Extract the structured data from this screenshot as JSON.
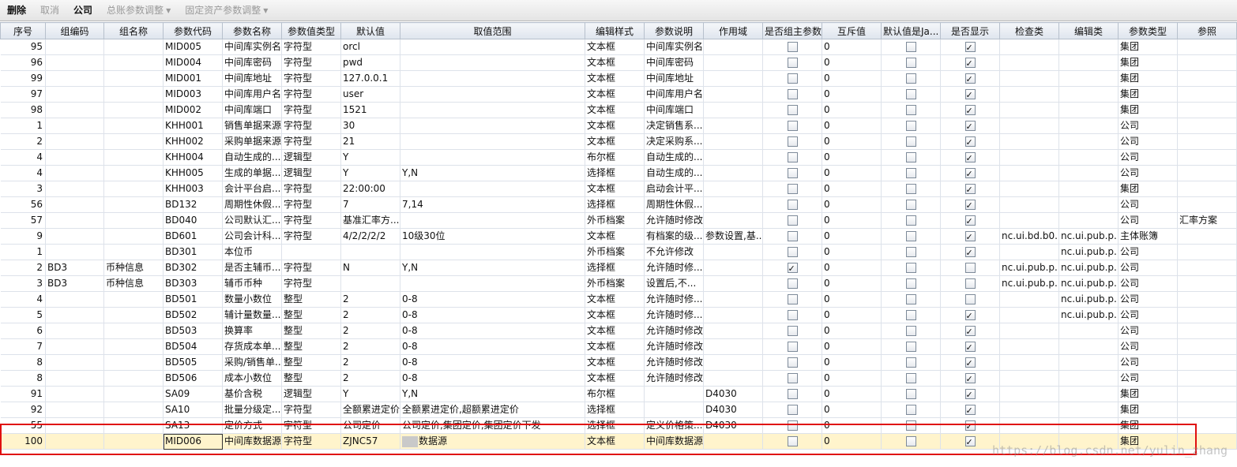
{
  "toolbar": {
    "delete_label": "删除",
    "cancel_label": "取消",
    "company_label": "公司",
    "ledger_params_label": "总账参数调整",
    "asset_params_label": "固定资产参数调整"
  },
  "columns": [
    "序号",
    "组编码",
    "组名称",
    "参数代码",
    "参数名称",
    "参数值类型",
    "默认值",
    "取值范围",
    "编辑样式",
    "参数说明",
    "作用域",
    "是否组主参数",
    "互斥值",
    "默认值是Ja...",
    "是否显示",
    "检查类",
    "编辑类",
    "参数类型",
    "参照"
  ],
  "rows": [
    {
      "seq": "95",
      "gcode": "",
      "gname": "",
      "code": "MID005",
      "name": "中间库实例名",
      "vtype": "字符型",
      "def": "orcl",
      "range": "",
      "style": "文本框",
      "desc": "中间库实例名",
      "scope": "",
      "main": false,
      "mutex": "0",
      "java": false,
      "show": true,
      "check": "",
      "edit": "",
      "ptype": "集团",
      "ref": ""
    },
    {
      "seq": "96",
      "gcode": "",
      "gname": "",
      "code": "MID004",
      "name": "中间库密码",
      "vtype": "字符型",
      "def": "pwd",
      "range": "",
      "style": "文本框",
      "desc": "中间库密码",
      "scope": "",
      "main": false,
      "mutex": "0",
      "java": false,
      "show": true,
      "check": "",
      "edit": "",
      "ptype": "集团",
      "ref": ""
    },
    {
      "seq": "99",
      "gcode": "",
      "gname": "",
      "code": "MID001",
      "name": "中间库地址",
      "vtype": "字符型",
      "def": "127.0.0.1",
      "range": "",
      "style": "文本框",
      "desc": "中间库地址",
      "scope": "",
      "main": false,
      "mutex": "0",
      "java": false,
      "show": true,
      "check": "",
      "edit": "",
      "ptype": "集团",
      "ref": ""
    },
    {
      "seq": "97",
      "gcode": "",
      "gname": "",
      "code": "MID003",
      "name": "中间库用户名",
      "vtype": "字符型",
      "def": "user",
      "range": "",
      "style": "文本框",
      "desc": "中间库用户名",
      "scope": "",
      "main": false,
      "mutex": "0",
      "java": false,
      "show": true,
      "check": "",
      "edit": "",
      "ptype": "集团",
      "ref": ""
    },
    {
      "seq": "98",
      "gcode": "",
      "gname": "",
      "code": "MID002",
      "name": "中间库端口",
      "vtype": "字符型",
      "def": "1521",
      "range": "",
      "style": "文本框",
      "desc": "中间库端口",
      "scope": "",
      "main": false,
      "mutex": "0",
      "java": false,
      "show": true,
      "check": "",
      "edit": "",
      "ptype": "集团",
      "ref": ""
    },
    {
      "seq": "1",
      "gcode": "",
      "gname": "",
      "code": "KHH001",
      "name": "销售单据来源",
      "vtype": "字符型",
      "def": "30",
      "range": "",
      "style": "文本框",
      "desc": "决定销售系...",
      "scope": "",
      "main": false,
      "mutex": "0",
      "java": false,
      "show": true,
      "check": "",
      "edit": "",
      "ptype": "公司",
      "ref": ""
    },
    {
      "seq": "2",
      "gcode": "",
      "gname": "",
      "code": "KHH002",
      "name": "采购单据来源",
      "vtype": "字符型",
      "def": "21",
      "range": "",
      "style": "文本框",
      "desc": "决定采购系...",
      "scope": "",
      "main": false,
      "mutex": "0",
      "java": false,
      "show": true,
      "check": "",
      "edit": "",
      "ptype": "公司",
      "ref": ""
    },
    {
      "seq": "4",
      "gcode": "",
      "gname": "",
      "code": "KHH004",
      "name": "自动生成的...",
      "vtype": "逻辑型",
      "def": "Y",
      "range": "",
      "style": "布尔框",
      "desc": "自动生成的...",
      "scope": "",
      "main": false,
      "mutex": "0",
      "java": false,
      "show": true,
      "check": "",
      "edit": "",
      "ptype": "公司",
      "ref": ""
    },
    {
      "seq": "4",
      "gcode": "",
      "gname": "",
      "code": "KHH005",
      "name": "生成的单据...",
      "vtype": "逻辑型",
      "def": "Y",
      "range": "Y,N",
      "style": "选择框",
      "desc": "自动生成的...",
      "scope": "",
      "main": false,
      "mutex": "0",
      "java": false,
      "show": true,
      "check": "",
      "edit": "",
      "ptype": "公司",
      "ref": ""
    },
    {
      "seq": "3",
      "gcode": "",
      "gname": "",
      "code": "KHH003",
      "name": "会计平台启...",
      "vtype": "字符型",
      "def": "22:00:00",
      "range": "",
      "style": "文本框",
      "desc": "启动会计平...",
      "scope": "",
      "main": false,
      "mutex": "0",
      "java": false,
      "show": true,
      "check": "",
      "edit": "",
      "ptype": "集团",
      "ref": ""
    },
    {
      "seq": "56",
      "gcode": "",
      "gname": "",
      "code": "BD132",
      "name": "周期性休假...",
      "vtype": "字符型",
      "def": "7",
      "range": "7,14",
      "style": "选择框",
      "desc": "周期性休假...",
      "scope": "",
      "main": false,
      "mutex": "0",
      "java": false,
      "show": true,
      "check": "",
      "edit": "",
      "ptype": "公司",
      "ref": ""
    },
    {
      "seq": "57",
      "gcode": "",
      "gname": "",
      "code": "BD040",
      "name": "公司默认汇...",
      "vtype": "字符型",
      "def": "基准汇率方...",
      "range": "",
      "style": "外币档案",
      "desc": "允许随时修改",
      "scope": "",
      "main": false,
      "mutex": "0",
      "java": false,
      "show": true,
      "check": "",
      "edit": "",
      "ptype": "公司",
      "ref": "汇率方案"
    },
    {
      "seq": "9",
      "gcode": "",
      "gname": "",
      "code": "BD601",
      "name": "公司会计科...",
      "vtype": "字符型",
      "def": "4/2/2/2/2",
      "range": "10级30位",
      "style": "文本框",
      "desc": "有档案的级...",
      "scope": "参数设置,基...",
      "main": false,
      "mutex": "0",
      "java": false,
      "show": true,
      "check": "nc.ui.bd.b0...",
      "edit": "nc.ui.pub.p...",
      "ptype": "主体账簿",
      "ref": ""
    },
    {
      "seq": "1",
      "gcode": "",
      "gname": "",
      "code": "BD301",
      "name": "本位币",
      "vtype": "",
      "def": "",
      "range": "",
      "style": "外币档案",
      "desc": "不允许修改",
      "scope": "",
      "main": false,
      "mutex": "0",
      "java": false,
      "show": true,
      "check": "",
      "edit": "nc.ui.pub.p...",
      "ptype": "公司",
      "ref": ""
    },
    {
      "seq": "2",
      "gcode": "BD3",
      "gname": "币种信息",
      "code": "BD302",
      "name": "是否主辅币...",
      "vtype": "字符型",
      "def": "N",
      "range": "Y,N",
      "style": "选择框",
      "desc": "允许随时修...",
      "scope": "",
      "main": true,
      "mutex": "0",
      "java": false,
      "show": false,
      "check": "nc.ui.pub.p...",
      "edit": "nc.ui.pub.p...",
      "ptype": "公司",
      "ref": ""
    },
    {
      "seq": "3",
      "gcode": "BD3",
      "gname": "币种信息",
      "code": "BD303",
      "name": "辅币币种",
      "vtype": "字符型",
      "def": "",
      "range": "",
      "style": "外币档案",
      "desc": "设置后,不...",
      "scope": "",
      "main": false,
      "mutex": "0",
      "java": false,
      "show": false,
      "check": "nc.ui.pub.p...",
      "edit": "nc.ui.pub.p...",
      "ptype": "公司",
      "ref": ""
    },
    {
      "seq": "4",
      "gcode": "",
      "gname": "",
      "code": "BD501",
      "name": "数量小数位",
      "vtype": "整型",
      "def": "2",
      "range": "0-8",
      "style": "文本框",
      "desc": "允许随时修...",
      "scope": "",
      "main": false,
      "mutex": "0",
      "java": false,
      "show": false,
      "check": "",
      "edit": "nc.ui.pub.p...",
      "ptype": "公司",
      "ref": ""
    },
    {
      "seq": "5",
      "gcode": "",
      "gname": "",
      "code": "BD502",
      "name": "辅计量数量...",
      "vtype": "整型",
      "def": "2",
      "range": "0-8",
      "style": "文本框",
      "desc": "允许随时修...",
      "scope": "",
      "main": false,
      "mutex": "0",
      "java": false,
      "show": true,
      "check": "",
      "edit": "nc.ui.pub.p...",
      "ptype": "公司",
      "ref": ""
    },
    {
      "seq": "6",
      "gcode": "",
      "gname": "",
      "code": "BD503",
      "name": "换算率",
      "vtype": "整型",
      "def": "2",
      "range": "0-8",
      "style": "文本框",
      "desc": "允许随时修改",
      "scope": "",
      "main": false,
      "mutex": "0",
      "java": false,
      "show": true,
      "check": "",
      "edit": "",
      "ptype": "公司",
      "ref": ""
    },
    {
      "seq": "7",
      "gcode": "",
      "gname": "",
      "code": "BD504",
      "name": "存货成本单...",
      "vtype": "整型",
      "def": "2",
      "range": "0-8",
      "style": "文本框",
      "desc": "允许随时修改",
      "scope": "",
      "main": false,
      "mutex": "0",
      "java": false,
      "show": true,
      "check": "",
      "edit": "",
      "ptype": "公司",
      "ref": ""
    },
    {
      "seq": "8",
      "gcode": "",
      "gname": "",
      "code": "BD505",
      "name": "采购/销售单...",
      "vtype": "整型",
      "def": "2",
      "range": "0-8",
      "style": "文本框",
      "desc": "允许随时修改",
      "scope": "",
      "main": false,
      "mutex": "0",
      "java": false,
      "show": true,
      "check": "",
      "edit": "",
      "ptype": "公司",
      "ref": ""
    },
    {
      "seq": "8",
      "gcode": "",
      "gname": "",
      "code": "BD506",
      "name": "成本小数位",
      "vtype": "整型",
      "def": "2",
      "range": "0-8",
      "style": "文本框",
      "desc": "允许随时修改",
      "scope": "",
      "main": false,
      "mutex": "0",
      "java": false,
      "show": true,
      "check": "",
      "edit": "",
      "ptype": "公司",
      "ref": ""
    },
    {
      "seq": "91",
      "gcode": "",
      "gname": "",
      "code": "SA09",
      "name": "基价含税",
      "vtype": "逻辑型",
      "def": "Y",
      "range": "Y,N",
      "style": "布尔框",
      "desc": "",
      "scope": "D4030",
      "main": false,
      "mutex": "0",
      "java": false,
      "show": true,
      "check": "",
      "edit": "",
      "ptype": "集团",
      "ref": ""
    },
    {
      "seq": "92",
      "gcode": "",
      "gname": "",
      "code": "SA10",
      "name": "批量分级定...",
      "vtype": "字符型",
      "def": "全额累进定价",
      "range": "全额累进定价,超额累进定价",
      "style": "选择框",
      "desc": "",
      "scope": "D4030",
      "main": false,
      "mutex": "0",
      "java": false,
      "show": true,
      "check": "",
      "edit": "",
      "ptype": "集团",
      "ref": ""
    },
    {
      "seq": "55",
      "gcode": "",
      "gname": "",
      "code": "SA13",
      "name": "定价方式",
      "vtype": "字符型",
      "def": "公司定价",
      "range": "公司定价,集团定价,集团定价下发",
      "style": "选择框",
      "desc": "定义价格策...",
      "scope": "D4030",
      "main": false,
      "mutex": "0",
      "java": false,
      "show": true,
      "check": "",
      "edit": "",
      "ptype": "集团",
      "ref": ""
    },
    {
      "seq": "100",
      "gcode": "",
      "gname": "",
      "code": "MID006",
      "name": "中间库数据源",
      "vtype": "字符型",
      "def": "ZJNC57",
      "range": "数据源",
      "style": "文本框",
      "desc": "中间库数据源",
      "scope": "",
      "main": false,
      "mutex": "0",
      "java": false,
      "show": true,
      "check": "",
      "edit": "",
      "ptype": "集团",
      "ref": ""
    }
  ],
  "watermark": "https://blog.csdn.net/yulin_zhang",
  "colors": {
    "selected_row": "#fff4cc",
    "annotation": "#e01010",
    "header": "#dfe5ee"
  }
}
